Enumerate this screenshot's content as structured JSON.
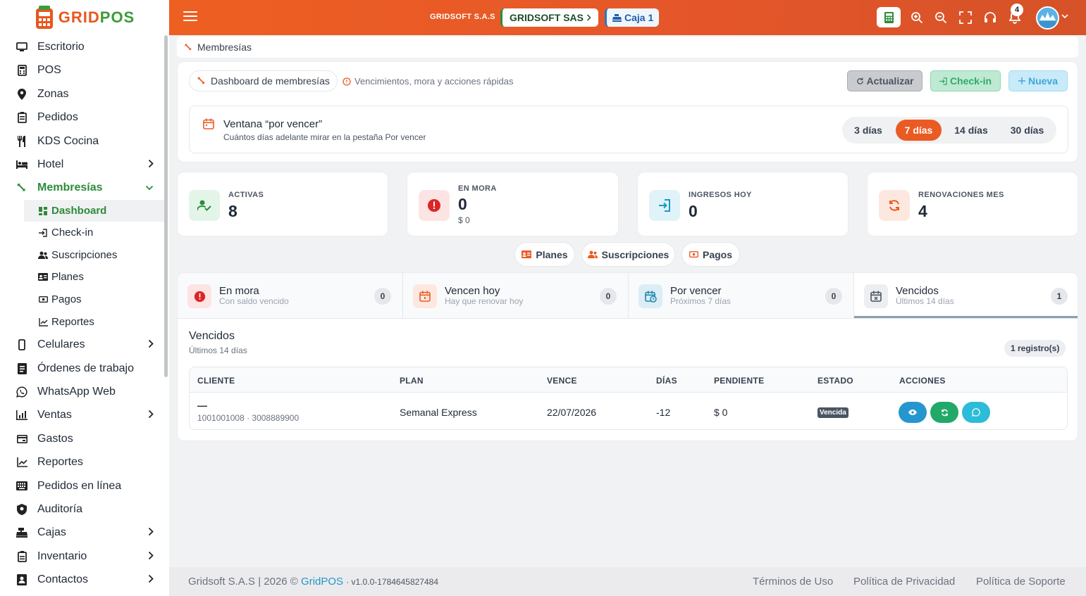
{
  "brand": {
    "logo_a": "GRID",
    "logo_b": "POS"
  },
  "sidebar": {
    "items": [
      {
        "label": "Escritorio"
      },
      {
        "label": "POS"
      },
      {
        "label": "Zonas"
      },
      {
        "label": "Pedidos"
      },
      {
        "label": "KDS Cocina"
      },
      {
        "label": "Hotel"
      },
      {
        "label": "Membresías"
      },
      {
        "label": "Celulares"
      },
      {
        "label": "Órdenes de trabajo"
      },
      {
        "label": "WhatsApp Web"
      },
      {
        "label": "Ventas"
      },
      {
        "label": "Gastos"
      },
      {
        "label": "Reportes"
      },
      {
        "label": "Pedidos en línea"
      },
      {
        "label": "Auditoría"
      },
      {
        "label": "Cajas"
      },
      {
        "label": "Inventario"
      },
      {
        "label": "Contactos"
      }
    ],
    "sub": [
      {
        "label": "Dashboard"
      },
      {
        "label": "Check-in"
      },
      {
        "label": "Suscripciones"
      },
      {
        "label": "Planes"
      },
      {
        "label": "Pagos"
      },
      {
        "label": "Reportes"
      }
    ]
  },
  "topbar": {
    "company": "GRIDSOFT S.A.S",
    "company_chip": "GRIDSOFT SAS",
    "caja": "Caja 1",
    "notifications": "4"
  },
  "breadcrumb": "Membresías",
  "header": {
    "dashboard_pill": "Dashboard de membresías",
    "hint": "Vencimientos, mora y acciones rápidas",
    "btn_refresh": "Actualizar",
    "btn_checkin": "Check-in",
    "btn_new": "Nueva"
  },
  "window": {
    "title": "Ventana “por vencer”",
    "subtitle": "Cuántos días adelante mirar en la pestaña Por vencer",
    "options": [
      "3 días",
      "7 días",
      "14 días",
      "30 días"
    ],
    "selected": "7 días"
  },
  "stats": [
    {
      "label": "ACTIVAS",
      "value": "8"
    },
    {
      "label": "EN MORA",
      "value": "0",
      "sub": "$ 0"
    },
    {
      "label": "INGRESOS HOY",
      "value": "0"
    },
    {
      "label": "RENOVACIONES MES",
      "value": "4"
    }
  ],
  "quick": [
    "Planes",
    "Suscripciones",
    "Pagos"
  ],
  "tabs": [
    {
      "title": "En mora",
      "sub": "Con saldo vencido",
      "count": "0"
    },
    {
      "title": "Vencen hoy",
      "sub": "Hay que renovar hoy",
      "count": "0"
    },
    {
      "title": "Por vencer",
      "sub": "Próximos 7 días",
      "count": "0"
    },
    {
      "title": "Vencidos",
      "sub": "Últimos 14 días",
      "count": "1"
    }
  ],
  "section": {
    "title": "Vencidos",
    "subtitle": "Últimos 14 días",
    "records": "1 registro(s)"
  },
  "table": {
    "headers": [
      "CLIENTE",
      "PLAN",
      "VENCE",
      "DÍAS",
      "PENDIENTE",
      "ESTADO",
      "ACCIONES"
    ],
    "rows": [
      {
        "client": "—",
        "client_sub": "1001001008 · 3008889900",
        "plan": "Semanal Express",
        "vence": "22/07/2026",
        "dias": "-12",
        "pendiente": "$ 0",
        "estado": "Vencida"
      }
    ]
  },
  "footer": {
    "left": "Gridsoft S.A.S | 2026 ©",
    "brand": "GridPOS",
    "version": "· v1.0.0-1784645827484",
    "links": [
      "Términos de Uso",
      "Política de Privacidad",
      "Política de Soporte"
    ]
  },
  "colors": {
    "primary": "#ea5b24",
    "green": "#2e8b3a",
    "teal": "#2eaa6c",
    "info": "#3ea8d8"
  }
}
